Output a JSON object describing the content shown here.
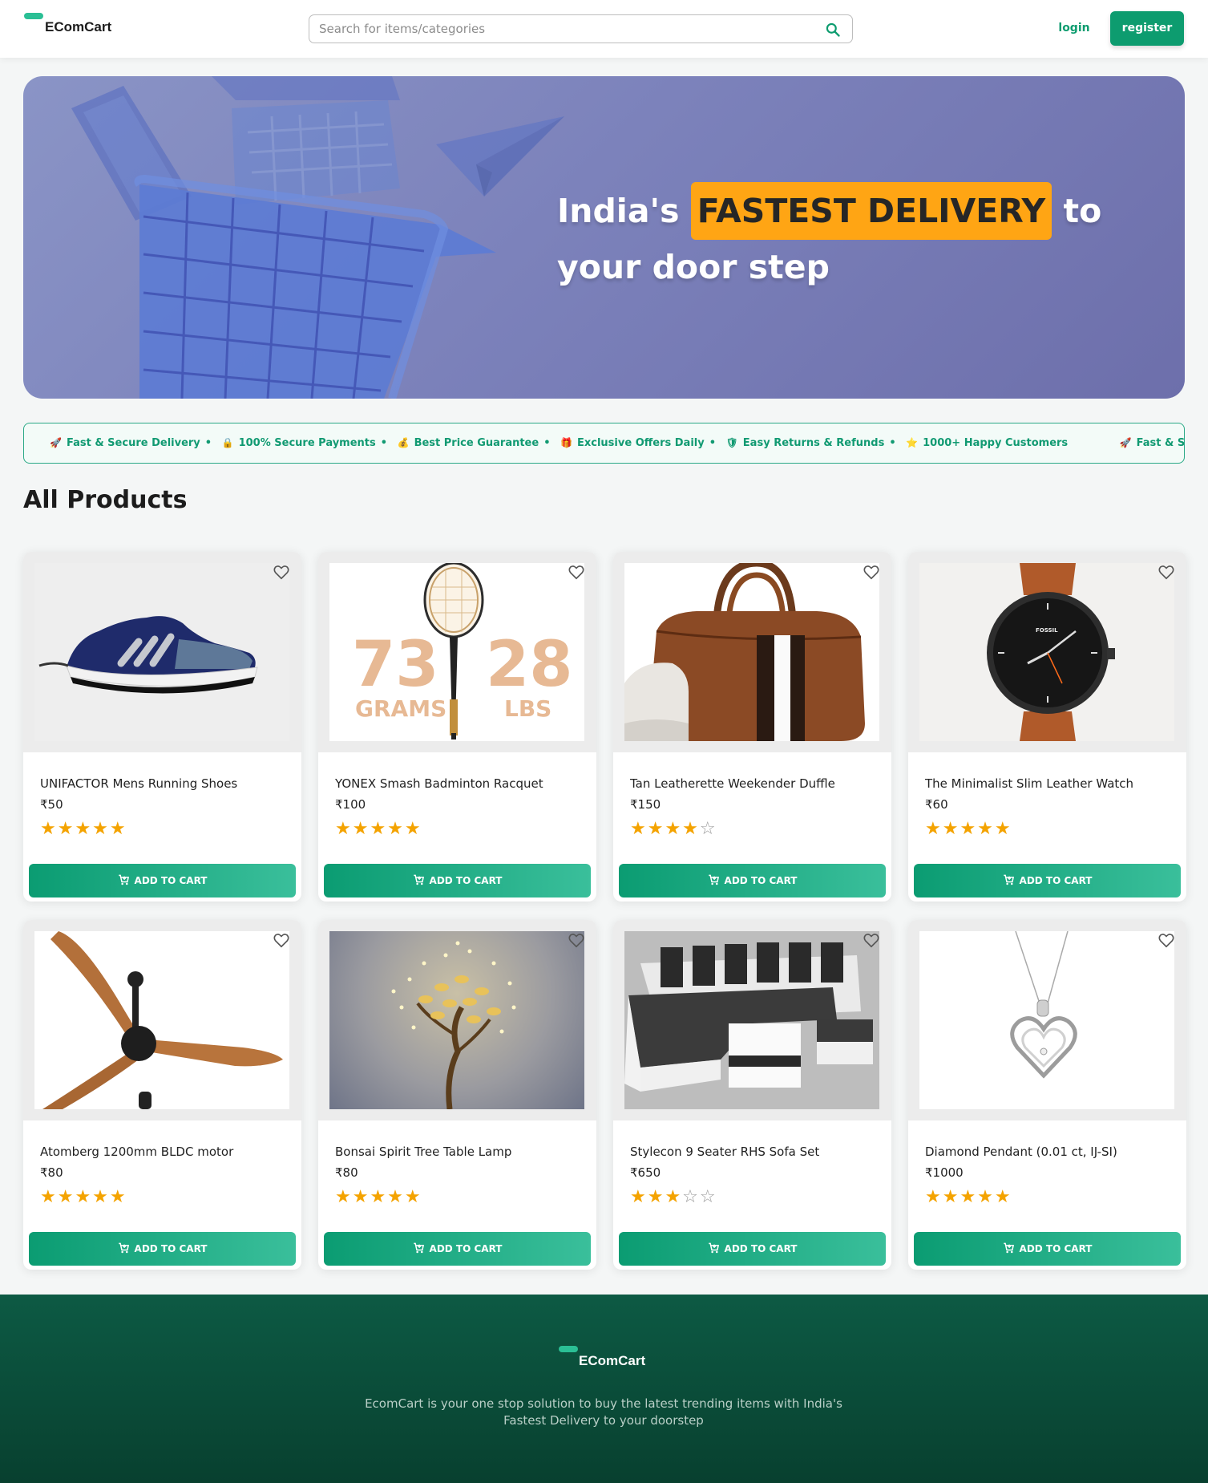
{
  "header": {
    "logo_text": "EComCart",
    "search_placeholder": "Search for items/categories",
    "login_label": "login",
    "register_label": "register"
  },
  "hero": {
    "line1_pre": "India's ",
    "highlight": "FASTEST DELIVERY",
    "line1_post": " to",
    "line2": "your door step"
  },
  "ticker": {
    "items": [
      {
        "icon": "rocket-icon",
        "label": "Fast & Secure Delivery"
      },
      {
        "icon": "lock-icon",
        "label": "100% Secure Payments"
      },
      {
        "icon": "money-bag-icon",
        "label": "Best Price Guarantee"
      },
      {
        "icon": "gift-icon",
        "label": "Exclusive Offers Daily"
      },
      {
        "icon": "shield-icon",
        "label": "Easy Returns & Refunds"
      },
      {
        "icon": "star-icon",
        "label": "1000+ Happy Customers"
      },
      {
        "icon": "rocket-icon",
        "label": "Fast & Secure Deli"
      }
    ]
  },
  "products_section": {
    "title": "All Products",
    "add_to_cart_label": "ADD TO CART",
    "products": [
      {
        "name": "UNIFACTOR Mens Running Shoes",
        "price": "₹50",
        "rating": 5
      },
      {
        "name": "YONEX Smash Badminton Racquet",
        "price": "₹100",
        "rating": 5
      },
      {
        "name": "Tan Leatherette Weekender Duffle",
        "price": "₹150",
        "rating": 4
      },
      {
        "name": "The Minimalist Slim Leather Watch",
        "price": "₹60",
        "rating": 5
      },
      {
        "name": "Atomberg 1200mm BLDC motor",
        "price": "₹80",
        "rating": 5
      },
      {
        "name": "Bonsai Spirit Tree Table Lamp",
        "price": "₹80",
        "rating": 5
      },
      {
        "name": "Stylecon 9 Seater RHS Sofa Set",
        "price": "₹650",
        "rating": 3
      },
      {
        "name": "Diamond Pendant (0.01 ct, IJ-SI)",
        "price": "₹1000",
        "rating": 5
      }
    ],
    "racquet_image_text": {
      "left_number": "73",
      "left_unit": "GRAMS",
      "right_number": "28",
      "right_unit": "LBS"
    },
    "watch_brand": "FOSSIL"
  },
  "footer": {
    "logo_text": "EComCart",
    "description": "EcomCart is your one stop solution to buy the latest trending items with India's Fastest Delivery to your doorstep"
  },
  "colors": {
    "accent": "#0d9c6f",
    "highlight": "#ffa514",
    "star": "#f4a300",
    "footer_bg": "#08402f"
  }
}
